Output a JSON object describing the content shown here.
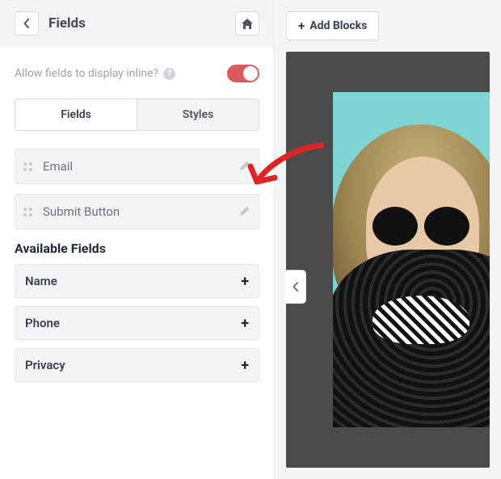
{
  "header": {
    "title": "Fields"
  },
  "allow_inline": {
    "label": "Allow fields to display inline?",
    "help_glyph": "?",
    "state": "on"
  },
  "tabs": {
    "fields": "Fields",
    "styles": "Styles",
    "active": "fields"
  },
  "active_fields": [
    {
      "label": "Email"
    },
    {
      "label": "Submit Button"
    }
  ],
  "available_title": "Available Fields",
  "available_fields": [
    {
      "label": "Name"
    },
    {
      "label": "Phone"
    },
    {
      "label": "Privacy"
    }
  ],
  "top_actions": {
    "add_blocks": "Add Blocks"
  },
  "colors": {
    "toggle_on": "#dd595f",
    "canvas_bg": "#4b4b4b"
  }
}
